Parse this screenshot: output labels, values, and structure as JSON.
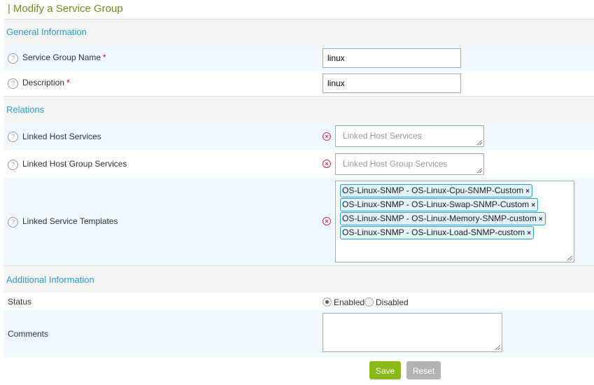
{
  "page": {
    "title": "Modify a Service Group"
  },
  "sections": {
    "general": "General Information",
    "relations": "Relations",
    "additional": "Additional Information"
  },
  "fields": {
    "name": {
      "label": "Service Group Name",
      "required": "*",
      "value": "linux"
    },
    "description": {
      "label": "Description",
      "required": "*",
      "value": "linux"
    },
    "linked_host_services": {
      "label": "Linked Host Services",
      "placeholder": "Linked Host Services"
    },
    "linked_host_group_services": {
      "label": "Linked Host Group Services",
      "placeholder": "Linked Host Group Services"
    },
    "linked_service_templates": {
      "label": "Linked Service Templates",
      "items": [
        "OS-Linux-SNMP - OS-Linux-Cpu-SNMP-Custom",
        "OS-Linux-SNMP - OS-Linux-Swap-SNMP-Custom",
        "OS-Linux-SNMP - OS-Linux-Memory-SNMP-custom",
        "OS-Linux-SNMP - OS-Linux-Load-SNMP-custom"
      ]
    },
    "status": {
      "label": "Status",
      "options": [
        "Enabled",
        "Disabled"
      ],
      "selected": "Enabled"
    },
    "comments": {
      "label": "Comments",
      "value": ""
    }
  },
  "icons": {
    "help": "?",
    "clear": "×",
    "chip_remove": "×"
  },
  "buttons": {
    "save": "Save",
    "reset": "Reset"
  },
  "colors": {
    "accent": "#2d9bd0",
    "title": "#6b8f1d",
    "save": "#88b917",
    "reset": "#b3b3b3",
    "error": "#d0314b"
  }
}
